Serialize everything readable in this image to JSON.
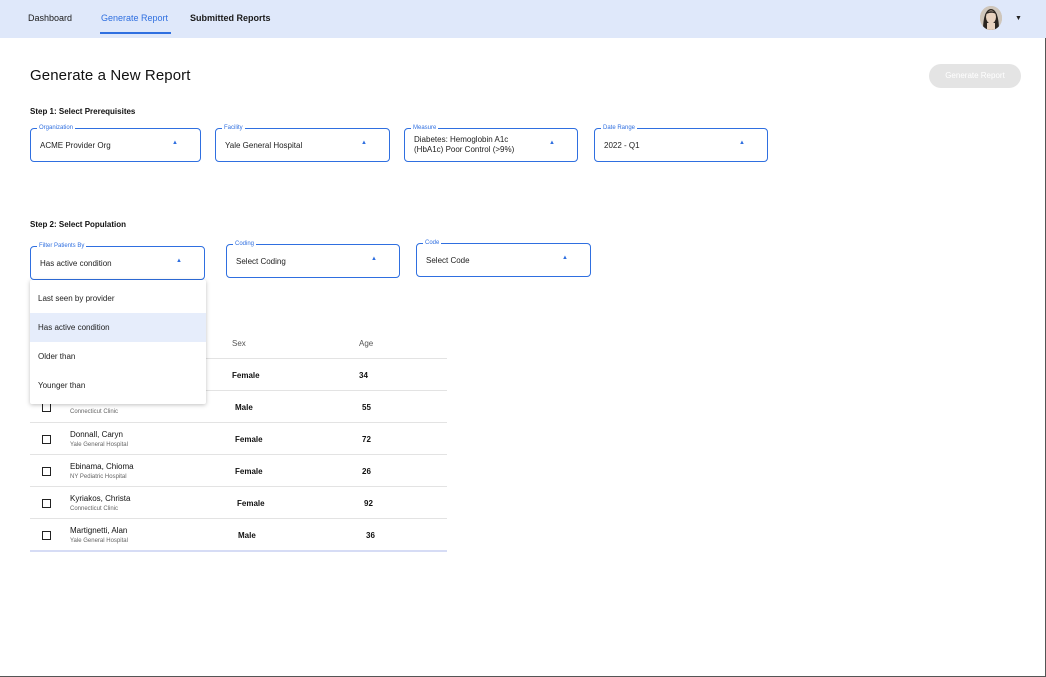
{
  "nav": {
    "tabs": [
      {
        "label": "Dashboard"
      },
      {
        "label": "Generate Report"
      },
      {
        "label": "Submitted Reports"
      }
    ],
    "active_tab": "Generate Report"
  },
  "page": {
    "title": "Generate a New Report",
    "generate_button": "Generate Report"
  },
  "step1": {
    "label": "Step 1: Select Prerequisites",
    "fields": [
      {
        "legend": "Organization",
        "value": "ACME Provider Org"
      },
      {
        "legend": "Facility",
        "value": "Yale General Hospital"
      },
      {
        "legend": "Measure",
        "value": "Diabetes: Hemoglobin A1c (HbA1c) Poor Control (>9%)"
      },
      {
        "legend": "Date Range",
        "value": "2022 - Q1"
      }
    ]
  },
  "step2": {
    "label": "Step 2: Select Population",
    "fields": [
      {
        "legend": "Filter Patients By",
        "value": "Has active condition"
      },
      {
        "legend": "Coding",
        "value": "Select Coding"
      },
      {
        "legend": "Code",
        "value": "Select Code"
      }
    ]
  },
  "filter_dropdown": {
    "options": [
      "Last seen by provider",
      "Has active condition",
      "Older than",
      "Younger than"
    ],
    "selected": "Has active condition"
  },
  "table": {
    "headers": [
      "Sex",
      "Age"
    ],
    "rows": [
      {
        "name": "",
        "facility": "",
        "sex": "Female",
        "age": "34"
      },
      {
        "name": "",
        "facility": "Connecticut Clinic",
        "sex": "Male",
        "age": "55"
      },
      {
        "name": "Donnall, Caryn",
        "facility": "Yale General Hospital",
        "sex": "Female",
        "age": "72"
      },
      {
        "name": "Ebinama, Chioma",
        "facility": "NY Pediatric Hospital",
        "sex": "Female",
        "age": "26"
      },
      {
        "name": "Kyriakos, Christa",
        "facility": "Connecticut Clinic",
        "sex": "Female",
        "age": "92"
      },
      {
        "name": "Martignetti, Alan",
        "facility": "Yale General Hospital",
        "sex": "Male",
        "age": "36"
      }
    ]
  },
  "icons": {
    "field_arrow": "caret-up-icon",
    "avatar_caret": "caret-down-icon"
  },
  "colors": {
    "accent": "#2f6fe0",
    "nav_bg": "#dfe8fa",
    "selected_option_bg": "#e6edfb",
    "disabled_button": "#e4e4e4"
  }
}
